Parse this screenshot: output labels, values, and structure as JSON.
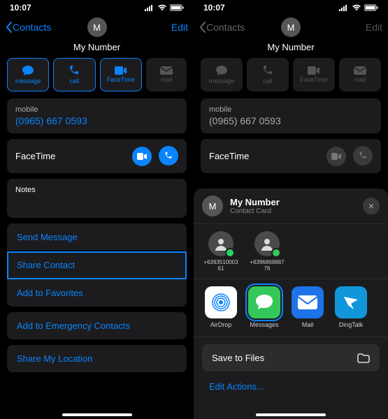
{
  "statusbar": {
    "time": "10:07"
  },
  "left": {
    "nav": {
      "back": "Contacts",
      "edit": "Edit"
    },
    "contact": {
      "avatar_initial": "M",
      "name": "My Number"
    },
    "actions": {
      "message": "message",
      "call": "call",
      "facetime": "FaceTime",
      "mail": "mail"
    },
    "phone": {
      "label": "mobile",
      "number": "(0965) 667 0593"
    },
    "facetime_label": "FaceTime",
    "notes_label": "Notes",
    "list1": {
      "send_message": "Send Message",
      "share_contact": "Share Contact",
      "add_favorites": "Add to Favorites"
    },
    "emergency": "Add to Emergency Contacts",
    "share_location": "Share My Location"
  },
  "right": {
    "nav": {
      "back": "Contacts",
      "edit": "Edit"
    },
    "contact": {
      "avatar_initial": "M",
      "name": "My Number"
    },
    "actions": {
      "message": "message",
      "call": "call",
      "facetime": "FaceTime",
      "mail": "mail"
    },
    "phone": {
      "label": "mobile",
      "number": "(0965) 667 0593"
    },
    "facetime_label": "FaceTime"
  },
  "sheet": {
    "avatar_initial": "M",
    "title": "My Number",
    "subtitle": "Contact Card",
    "contacts": [
      {
        "label": "+6393510003\n61"
      },
      {
        "label": "+6396869887\n76"
      }
    ],
    "apps": {
      "airdrop": "AirDrop",
      "messages": "Messages",
      "mail": "Mail",
      "dingtalk": "DingTalk"
    },
    "save_files": "Save to Files",
    "edit_actions": "Edit Actions..."
  }
}
